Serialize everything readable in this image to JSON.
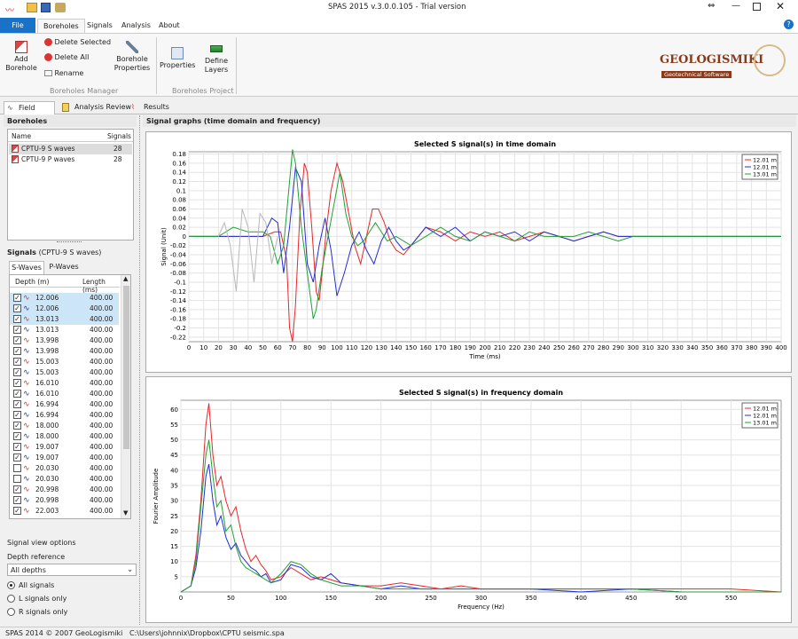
{
  "window": {
    "title": "SPAS 2015 v.3.0.0.105 - Trial version"
  },
  "menu": {
    "file": "File",
    "tabs": [
      "Boreholes",
      "Signals",
      "Analysis",
      "About"
    ]
  },
  "ribbon": {
    "add_borehole": "Add Borehole",
    "delete_selected": "Delete Selected",
    "delete_all": "Delete All",
    "rename": "Rename",
    "borehole_properties": "Borehole Properties",
    "properties": "Properties",
    "define_layers": "Define Layers",
    "group_manager": "Boreholes Manager",
    "group_project": "Boreholes Project",
    "logo_title": "GEOLOGISMIKI",
    "logo_sub": "Geotechnical Software"
  },
  "view_tabs": [
    "Field Data",
    "Analysis Review",
    "Results"
  ],
  "boreholes": {
    "title": "Boreholes",
    "col_name": "Name",
    "col_signals": "Signals",
    "rows": [
      {
        "name": "CPTU-9 S waves",
        "signals": "28"
      },
      {
        "name": "CPTU-9 P waves",
        "signals": "28"
      }
    ]
  },
  "signals": {
    "title": "Signals",
    "subtitle": "(CPTU-9 S waves)",
    "tabs": [
      "S-Waves",
      "P-Waves"
    ],
    "col_depth": "Depth (m)",
    "col_length": "Length (ms)",
    "rows": [
      {
        "depth": "12.006",
        "length": "400.00",
        "checked": true,
        "sel": true
      },
      {
        "depth": "12.006",
        "length": "400.00",
        "checked": true,
        "sel": true
      },
      {
        "depth": "13.013",
        "length": "400.00",
        "checked": true,
        "sel": true
      },
      {
        "depth": "13.013",
        "length": "400.00",
        "checked": true,
        "sel": false
      },
      {
        "depth": "13.998",
        "length": "400.00",
        "checked": true,
        "sel": false
      },
      {
        "depth": "13.998",
        "length": "400.00",
        "checked": true,
        "sel": false
      },
      {
        "depth": "15.003",
        "length": "400.00",
        "checked": true,
        "sel": false
      },
      {
        "depth": "15.003",
        "length": "400.00",
        "checked": true,
        "sel": false
      },
      {
        "depth": "16.010",
        "length": "400.00",
        "checked": true,
        "sel": false
      },
      {
        "depth": "16.010",
        "length": "400.00",
        "checked": true,
        "sel": false
      },
      {
        "depth": "16.994",
        "length": "400.00",
        "checked": true,
        "sel": false
      },
      {
        "depth": "16.994",
        "length": "400.00",
        "checked": true,
        "sel": false
      },
      {
        "depth": "18.000",
        "length": "400.00",
        "checked": true,
        "sel": false
      },
      {
        "depth": "18.000",
        "length": "400.00",
        "checked": true,
        "sel": false
      },
      {
        "depth": "19.007",
        "length": "400.00",
        "checked": true,
        "sel": false
      },
      {
        "depth": "19.007",
        "length": "400.00",
        "checked": true,
        "sel": false
      },
      {
        "depth": "20.030",
        "length": "400.00",
        "checked": false,
        "sel": false
      },
      {
        "depth": "20.030",
        "length": "400.00",
        "checked": false,
        "sel": false
      },
      {
        "depth": "20.998",
        "length": "400.00",
        "checked": true,
        "sel": false
      },
      {
        "depth": "20.998",
        "length": "400.00",
        "checked": true,
        "sel": false
      },
      {
        "depth": "22.003",
        "length": "400.00",
        "checked": true,
        "sel": false
      }
    ]
  },
  "view_options": {
    "title": "Signal view options",
    "depth_ref_label": "Depth reference",
    "depth_ref_value": "All depths",
    "radios": [
      {
        "label": "All signals",
        "on": true
      },
      {
        "label": "L signals only",
        "on": false
      },
      {
        "label": "R signals only",
        "on": false
      }
    ]
  },
  "graphs_title": "Signal graphs (time domain and frequency)",
  "legend": [
    "12.01 m",
    "12.01 m",
    "13.01 m"
  ],
  "colors": {
    "red": "#e8262a",
    "blue": "#1f2fd6",
    "green": "#21a035",
    "gray": "#b8b8b8"
  },
  "status": {
    "left": "SPAS 2014 © 2007 GeoLogismiki",
    "path": "C:\\Users\\johnnix\\Dropbox\\CPTU seismic.spa"
  },
  "chart_data": [
    {
      "type": "line",
      "title": "Selected S signal(s) in time domain",
      "xlabel": "Time (ms)",
      "ylabel": "Signal (Unit)",
      "xlim": [
        0,
        400
      ],
      "ylim": [
        -0.23,
        0.185
      ],
      "xticks": [
        0,
        10,
        20,
        30,
        40,
        50,
        60,
        70,
        80,
        90,
        100,
        110,
        120,
        130,
        140,
        150,
        160,
        170,
        180,
        190,
        200,
        210,
        220,
        230,
        240,
        250,
        260,
        270,
        280,
        290,
        300,
        310,
        320,
        330,
        340,
        350,
        360,
        370,
        380,
        390,
        400
      ],
      "yticks": [
        0.18,
        0.16,
        0.14,
        0.12,
        0.1,
        0.08,
        0.06,
        0.04,
        0.02,
        0,
        -0.02,
        -0.04,
        -0.06,
        -0.08,
        -0.1,
        -0.12,
        -0.14,
        -0.16,
        -0.18,
        -0.2,
        -0.22
      ],
      "legend": "top-right",
      "grid": true,
      "series": [
        {
          "name": "12.01 m",
          "color": "red",
          "x": [
            0,
            20,
            40,
            50,
            58,
            62,
            66,
            68,
            70,
            72,
            75,
            78,
            80,
            83,
            86,
            88,
            90,
            93,
            96,
            100,
            104,
            108,
            112,
            116,
            120,
            124,
            128,
            132,
            136,
            140,
            145,
            150,
            160,
            170,
            180,
            190,
            200,
            210,
            220,
            230,
            240,
            250,
            260,
            270,
            280,
            290,
            300,
            320,
            340,
            360,
            380,
            400
          ],
          "y": [
            0,
            0,
            0,
            0,
            0.01,
            0.01,
            -0.05,
            -0.2,
            -0.23,
            -0.15,
            0.05,
            0.16,
            0.14,
            0.02,
            -0.12,
            -0.14,
            -0.08,
            0.02,
            0.1,
            0.16,
            0.12,
            0.05,
            -0.02,
            -0.06,
            0,
            0.06,
            0.06,
            0.03,
            -0.01,
            -0.03,
            -0.04,
            -0.02,
            0.02,
            0.01,
            -0.01,
            0.01,
            0,
            0.01,
            -0.01,
            0,
            0.01,
            0,
            -0.01,
            0,
            0.01,
            0,
            0,
            0,
            0,
            0,
            0,
            0
          ]
        },
        {
          "name": "12.01 m",
          "color": "blue",
          "x": [
            0,
            20,
            40,
            50,
            56,
            60,
            64,
            68,
            72,
            76,
            80,
            84,
            88,
            92,
            96,
            100,
            105,
            110,
            115,
            120,
            125,
            130,
            135,
            140,
            145,
            150,
            160,
            170,
            180,
            190,
            200,
            210,
            220,
            230,
            240,
            250,
            260,
            270,
            280,
            290,
            300,
            320,
            340,
            360,
            380,
            400
          ],
          "y": [
            0,
            0,
            0,
            0,
            0.04,
            0.03,
            -0.08,
            0.02,
            0.15,
            0.12,
            -0.06,
            -0.1,
            -0.02,
            0.04,
            -0.03,
            -0.13,
            -0.08,
            -0.02,
            0.01,
            -0.03,
            -0.06,
            -0.01,
            0.02,
            -0.01,
            -0.03,
            -0.02,
            0.02,
            0,
            0.02,
            -0.01,
            0.01,
            0,
            0.01,
            -0.01,
            0.01,
            0,
            -0.01,
            0,
            0.01,
            0,
            0,
            0,
            0,
            0,
            0,
            0
          ]
        },
        {
          "name": "13.01 m",
          "color": "green",
          "x": [
            0,
            10,
            20,
            30,
            40,
            50,
            55,
            60,
            64,
            68,
            70,
            72,
            76,
            80,
            84,
            86,
            90,
            94,
            98,
            102,
            106,
            110,
            114,
            118,
            122,
            126,
            130,
            134,
            140,
            150,
            160,
            170,
            180,
            190,
            200,
            210,
            220,
            230,
            240,
            250,
            260,
            270,
            280,
            290,
            300,
            320,
            340,
            360,
            380,
            400
          ],
          "y": [
            0,
            0,
            0,
            0.02,
            0.01,
            0.01,
            0,
            -0.06,
            -0.02,
            0.12,
            0.19,
            0.16,
            0.02,
            -0.08,
            -0.18,
            -0.16,
            -0.07,
            0,
            0.07,
            0.14,
            0.05,
            0,
            -0.02,
            -0.01,
            0.01,
            0.03,
            0.01,
            -0.01,
            0,
            -0.02,
            0,
            0.02,
            0,
            -0.01,
            0.01,
            0,
            -0.01,
            0.01,
            0,
            0,
            0,
            0.01,
            0,
            -0.01,
            0,
            0,
            0,
            0,
            0,
            0
          ]
        }
      ]
    },
    {
      "type": "line",
      "title": "Selected S signal(s) in frequency domain",
      "xlabel": "Frequency (Hz)",
      "ylabel": "Fourier Amplitude",
      "xlim": [
        0,
        600
      ],
      "ylim": [
        0,
        63
      ],
      "xticks": [
        0,
        50,
        100,
        150,
        200,
        250,
        300,
        350,
        400,
        450,
        500,
        550
      ],
      "yticks": [
        60,
        55,
        50,
        45,
        40,
        35,
        30,
        25,
        20,
        15,
        10,
        5
      ],
      "legend": "top-right",
      "grid": true,
      "series": [
        {
          "name": "12.01 m",
          "color": "red",
          "x": [
            0,
            10,
            15,
            20,
            25,
            28,
            32,
            36,
            40,
            45,
            50,
            55,
            60,
            65,
            70,
            75,
            80,
            85,
            90,
            100,
            110,
            120,
            130,
            140,
            150,
            160,
            180,
            200,
            220,
            240,
            260,
            280,
            300,
            350,
            400,
            450,
            500,
            550,
            600
          ],
          "y": [
            0,
            2,
            12,
            30,
            55,
            62,
            45,
            35,
            38,
            30,
            25,
            28,
            20,
            14,
            10,
            12,
            9,
            7,
            4,
            5,
            8,
            6,
            4,
            5,
            4,
            3,
            2,
            2,
            3,
            2,
            1,
            2,
            1,
            1,
            1,
            1,
            1,
            1,
            0
          ]
        },
        {
          "name": "12.01 m",
          "color": "blue",
          "x": [
            0,
            10,
            15,
            20,
            25,
            28,
            32,
            36,
            40,
            45,
            50,
            55,
            60,
            65,
            70,
            75,
            80,
            85,
            90,
            100,
            110,
            120,
            130,
            140,
            150,
            160,
            180,
            200,
            220,
            240,
            260,
            280,
            300,
            350,
            400,
            450,
            500,
            550,
            600
          ],
          "y": [
            0,
            2,
            8,
            20,
            38,
            42,
            30,
            22,
            25,
            18,
            14,
            16,
            12,
            10,
            8,
            7,
            5,
            6,
            3,
            4,
            9,
            8,
            5,
            4,
            6,
            3,
            2,
            1,
            2,
            1,
            1,
            1,
            1,
            1,
            0,
            1,
            0,
            0,
            0
          ]
        },
        {
          "name": "13.01 m",
          "color": "green",
          "x": [
            0,
            10,
            15,
            20,
            25,
            28,
            32,
            36,
            40,
            45,
            50,
            55,
            60,
            65,
            70,
            75,
            80,
            85,
            90,
            100,
            110,
            120,
            130,
            140,
            150,
            160,
            180,
            200,
            220,
            240,
            260,
            280,
            300,
            350,
            400,
            450,
            500,
            550,
            600
          ],
          "y": [
            0,
            2,
            10,
            28,
            45,
            50,
            38,
            28,
            30,
            20,
            22,
            15,
            10,
            8,
            7,
            6,
            5,
            4,
            3,
            6,
            10,
            9,
            6,
            4,
            3,
            2,
            2,
            1,
            1,
            1,
            1,
            1,
            1,
            1,
            1,
            1,
            0,
            0,
            0
          ]
        }
      ]
    }
  ]
}
